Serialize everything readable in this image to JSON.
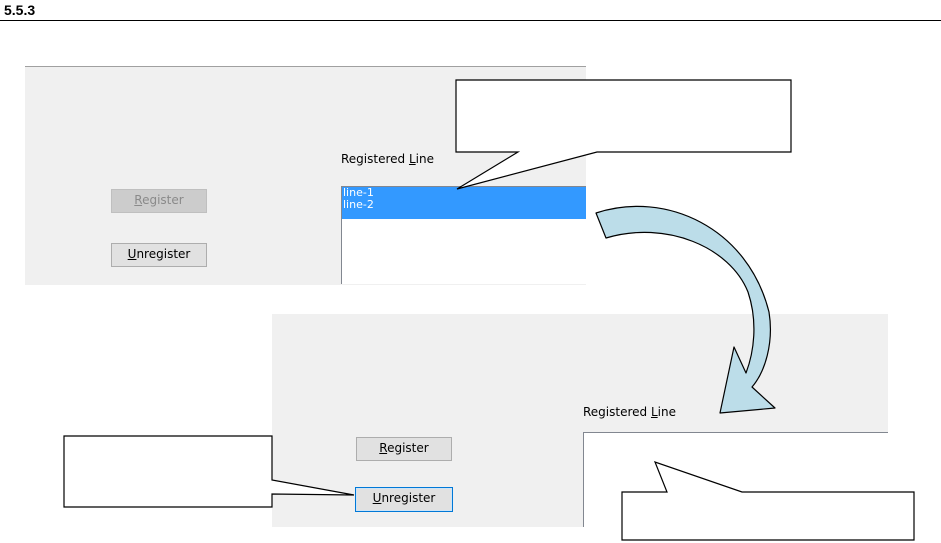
{
  "heading": "5.5.3",
  "before": {
    "list_label": "Registered Line",
    "register_button": "Register",
    "unregister_button": "Unregister",
    "list_items": [
      "line-1",
      "line-2"
    ]
  },
  "after": {
    "list_label": "Registered Line",
    "register_button": "Register",
    "unregister_button": "Unregister",
    "list_items": []
  },
  "colors": {
    "selection": "#3399ff",
    "arrow_fill": "#bcdde9",
    "panel": "#f0f0f0"
  }
}
